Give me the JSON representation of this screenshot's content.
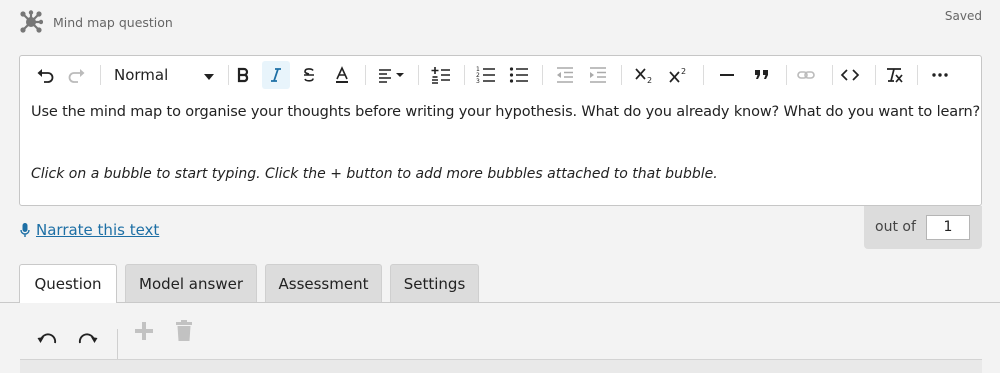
{
  "app": {
    "title": "Mind map question",
    "status": "Saved",
    "icon": "mindmap-icon"
  },
  "editor": {
    "toolbar": {
      "format_value": "Normal",
      "items": [
        "undo-icon",
        "redo-icon",
        "bold-icon",
        "italic-icon",
        "strikethrough-icon",
        "text-color-icon",
        "align-icon",
        "line-height-icon",
        "numbered-list-icon",
        "bulleted-list-icon",
        "outdent-icon",
        "indent-icon",
        "subscript-icon",
        "superscript-icon",
        "horizontal-rule-icon",
        "blockquote-icon",
        "link-icon",
        "code-icon",
        "clear-format-icon",
        "more-icon"
      ]
    },
    "paragraph": "Use the mind map to organise your thoughts before writing your hypothesis. What do you already know? What do you want to learn?",
    "hint": "Click on a bubble to start typing. Click the + button to add more bubbles attached to that bubble."
  },
  "narrate": {
    "label": "Narrate this text",
    "icon": "microphone-icon"
  },
  "score": {
    "label": "out of",
    "value": "1"
  },
  "tabs": [
    {
      "label": "Question",
      "active": true
    },
    {
      "label": "Model answer",
      "active": false
    },
    {
      "label": "Assessment",
      "active": false
    },
    {
      "label": "Settings",
      "active": false
    }
  ],
  "mindmap_toolbar": {
    "items": [
      "undo-icon",
      "redo-icon",
      "add-icon",
      "delete-icon"
    ]
  },
  "colors": {
    "link": "#1d6fa5",
    "active_button_bg": "#e8f4fb",
    "page_bg": "#f3f3f3",
    "tab_bg": "#dcdcdc"
  }
}
